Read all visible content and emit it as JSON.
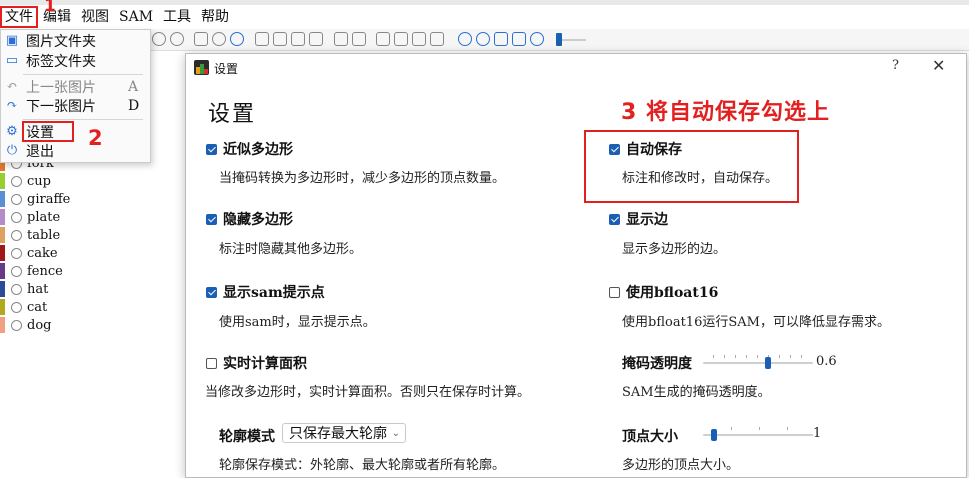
{
  "menubar": {
    "items": [
      "文件",
      "编辑",
      "视图",
      "SAM",
      "工具",
      "帮助"
    ]
  },
  "file_menu": {
    "items": [
      {
        "label": "图片文件夹",
        "shortcut": "",
        "icon": "image-folder-icon"
      },
      {
        "label": "标签文件夹",
        "shortcut": "",
        "icon": "folder-icon"
      },
      {
        "label": "上一张图片",
        "shortcut": "A",
        "icon": "back-arrow-icon"
      },
      {
        "label": "下一张图片",
        "shortcut": "D",
        "icon": "forward-arrow-icon"
      },
      {
        "label": "设置",
        "shortcut": "",
        "icon": "gear-icon"
      },
      {
        "label": "退出",
        "shortcut": "",
        "icon": "power-icon"
      }
    ]
  },
  "labels": [
    {
      "name": "fork",
      "color": "#e07a2e"
    },
    {
      "name": "cup",
      "color": "#9acd32"
    },
    {
      "name": "giraffe",
      "color": "#5a8fd6"
    },
    {
      "name": "plate",
      "color": "#b48ac8"
    },
    {
      "name": "table",
      "color": "#e0a060"
    },
    {
      "name": "cake",
      "color": "#a01818"
    },
    {
      "name": "fence",
      "color": "#6a3a8a"
    },
    {
      "name": "hat",
      "color": "#2a4a9a"
    },
    {
      "name": "cat",
      "color": "#b0a820"
    },
    {
      "name": "dog",
      "color": "#f0a080"
    }
  ],
  "annotations": {
    "step1": "1",
    "step2": "2",
    "step3": "3  将自动保存勾选上"
  },
  "dialog": {
    "title": "设置",
    "help": "?",
    "close": "✕",
    "heading": "设置",
    "options": {
      "approx_polygon": {
        "label": "近似多边形",
        "checked": true,
        "desc": "当掩码转换为多边形时，减少多边形的顶点数量。"
      },
      "auto_save": {
        "label": "自动保存",
        "checked": true,
        "desc": "标注和修改时，自动保存。"
      },
      "hide_polygon": {
        "label": "隐藏多边形",
        "checked": true,
        "desc": "标注时隐藏其他多边形。"
      },
      "show_edge": {
        "label": "显示边",
        "checked": true,
        "desc": "显示多边形的边。"
      },
      "show_sam_points": {
        "label": "显示sam提示点",
        "checked": true,
        "desc": "使用sam时，显示提示点。"
      },
      "use_bfloat16": {
        "label": "使用bfloat16",
        "checked": false,
        "desc": "使用bfloat16运行SAM，可以降低显存需求。"
      },
      "realtime_area": {
        "label": "实时计算面积",
        "checked": false,
        "desc": "当修改多边形时，实时计算面积。否则只在保存时计算。"
      },
      "mask_opacity": {
        "label": "掩码透明度",
        "value": "0.6",
        "fraction": 0.6,
        "desc": "SAM生成的掩码透明度。"
      },
      "contour_mode": {
        "label": "轮廓模式",
        "value": "只保存最大轮廓",
        "desc": "轮廓保存模式：外轮廓、最大轮廓或者所有轮廓。"
      },
      "vertex_size": {
        "label": "顶点大小",
        "value": "1",
        "fraction": 0.08,
        "desc": "多边形的顶点大小。"
      }
    }
  },
  "colors": {
    "accent": "#1a5fb4",
    "annotation": "#e32020"
  }
}
